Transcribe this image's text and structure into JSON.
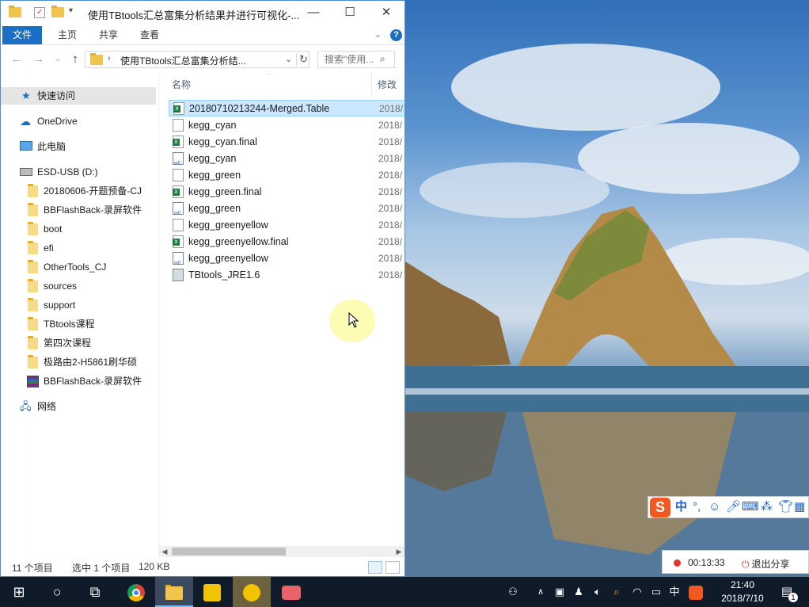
{
  "window": {
    "title": "使用TBtools汇总富集分析结果并进行可视化-...",
    "minimize": "—",
    "maximize": "☐",
    "close": "✕"
  },
  "ribbon": {
    "tabs": [
      "文件",
      "主页",
      "共享",
      "查看"
    ]
  },
  "address": {
    "path": "使用TBtools汇总富集分析结...",
    "search_placeholder": "搜索\"使用..."
  },
  "nav": {
    "items": [
      {
        "label": "快速访问",
        "icon": "star-icon",
        "selected": true
      },
      {
        "label": "OneDrive",
        "icon": "cloud-icon"
      },
      {
        "label": "此电脑",
        "icon": "computer-icon"
      },
      {
        "label": "ESD-USB (D:)",
        "icon": "usb-drive-icon"
      },
      {
        "label": "20180606-开题预备-CJ",
        "icon": "folder-icon"
      },
      {
        "label": "BBFlashBack-录屏软件",
        "icon": "folder-icon"
      },
      {
        "label": "boot",
        "icon": "folder-icon"
      },
      {
        "label": "efi",
        "icon": "folder-icon"
      },
      {
        "label": "OtherTools_CJ",
        "icon": "folder-icon"
      },
      {
        "label": "sources",
        "icon": "folder-icon"
      },
      {
        "label": "support",
        "icon": "folder-icon"
      },
      {
        "label": "TBtools课程",
        "icon": "folder-icon"
      },
      {
        "label": "第四次课程",
        "icon": "folder-icon"
      },
      {
        "label": "极路由2-H5861刷华硕",
        "icon": "folder-icon"
      },
      {
        "label": "BBFlashBack-录屏软件",
        "icon": "archive-icon"
      },
      {
        "label": "网络",
        "icon": "network-icon"
      }
    ]
  },
  "filelist": {
    "columns": {
      "name": "名称",
      "date": "修改日"
    },
    "files": [
      {
        "name": "20180710213244-Merged.Table",
        "type": "xls",
        "date": "2018/",
        "selected": true
      },
      {
        "name": "kegg_cyan",
        "type": "doc",
        "date": "2018/"
      },
      {
        "name": "kegg_cyan.final",
        "type": "xls",
        "date": "2018/"
      },
      {
        "name": "kegg_cyan",
        "type": "pdf",
        "date": "2018/"
      },
      {
        "name": "kegg_green",
        "type": "doc",
        "date": "2018/"
      },
      {
        "name": "kegg_green.final",
        "type": "xls",
        "date": "2018/"
      },
      {
        "name": "kegg_green",
        "type": "pdf",
        "date": "2018/"
      },
      {
        "name": "kegg_greenyellow",
        "type": "doc",
        "date": "2018/"
      },
      {
        "name": "kegg_greenyellow.final",
        "type": "xls",
        "date": "2018/"
      },
      {
        "name": "kegg_greenyellow",
        "type": "pdf",
        "date": "2018/"
      },
      {
        "name": "TBtools_JRE1.6",
        "type": "app",
        "date": "2018/"
      }
    ]
  },
  "status": {
    "count": "11 个项目",
    "selected": "选中 1 个项目",
    "size": "120 KB"
  },
  "ime": {
    "logo": "S",
    "mode": "中",
    "punct": "°,"
  },
  "recorder": {
    "time": "00:13:33",
    "stop_label": "退出分享"
  },
  "tray": {
    "ime_mode": "中",
    "time": "21:40",
    "date": "2018/7/10",
    "notif_count": "1"
  },
  "colors": {
    "accent": "#1a6fc4",
    "selection": "#cce8ff",
    "taskbar": "#101b2a",
    "folder": "#f1c54c"
  }
}
